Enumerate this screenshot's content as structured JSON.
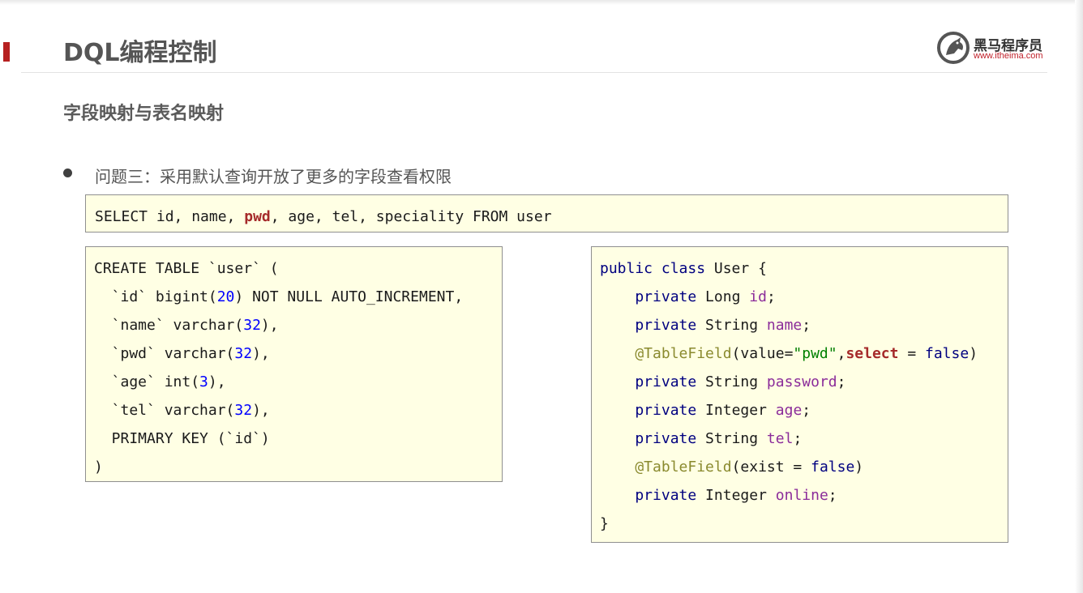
{
  "header": {
    "title": "DQL编程控制",
    "logo_name": "黑马程序员",
    "logo_url": "www.itheima.com"
  },
  "subtitle": "字段映射与表名映射",
  "question": "问题三：采用默认查询开放了更多的字段查看权限",
  "sql_query": {
    "t1": "SELECT id, name, ",
    "pwd": "pwd",
    "t2": ", age, tel, speciality FROM user"
  },
  "create_table": {
    "l1": "CREATE TABLE `user` (",
    "l2_a": "  `id` bigint(",
    "l2_n": "20",
    "l2_b": ") NOT NULL AUTO_INCREMENT,",
    "l3_a": "  `name` varchar(",
    "l3_n": "32",
    "l3_b": "),",
    "l4_a": "  `pwd` varchar(",
    "l4_n": "32",
    "l4_b": "),",
    "l5_a": "  `age` int(",
    "l5_n": "3",
    "l5_b": "),",
    "l6_a": "  `tel` varchar(",
    "l6_n": "32",
    "l6_b": "),",
    "l7": "  PRIMARY KEY (`id`)",
    "l8": ")"
  },
  "user_class": {
    "l1_kw": "public class",
    "l1_rest": " User {",
    "l2_kw": "    private",
    "l2_type": " Long ",
    "l2_f": "id",
    "l2_end": ";",
    "l3_kw": "    private",
    "l3_type": " String ",
    "l3_f": "name",
    "l3_end": ";",
    "l4_ann": "    @TableField",
    "l4_a": "(value=",
    "l4_str": "\"pwd\"",
    "l4_b": ",",
    "l4_sel": "select",
    "l4_c": " = ",
    "l4_false": "false",
    "l4_d": ")",
    "l5_kw": "    private",
    "l5_type": " String ",
    "l5_f": "password",
    "l5_end": ";",
    "l6_kw": "    private",
    "l6_type": " Integer ",
    "l6_f": "age",
    "l6_end": ";",
    "l7_kw": "    private",
    "l7_type": " String ",
    "l7_f": "tel",
    "l7_end": ";",
    "l8_ann": "    @TableField",
    "l8_a": "(exist = ",
    "l8_false": "false",
    "l8_b": ")",
    "l9_kw": "    private",
    "l9_type": " Integer ",
    "l9_f": "online",
    "l9_end": ";",
    "l10": "}"
  },
  "colors": {
    "accent": "#b62020",
    "code_background": "#ffffe4",
    "keyword": "#000080",
    "field": "#8b2c9a",
    "number": "#0000ff",
    "string": "#008000",
    "annotation": "#8a8a2e"
  }
}
